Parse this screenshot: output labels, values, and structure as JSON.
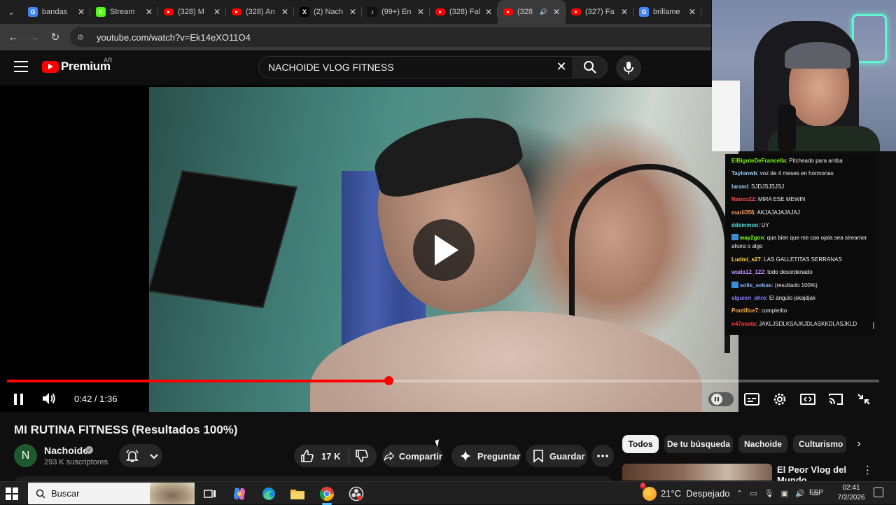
{
  "browser": {
    "tabs": [
      {
        "title": "bandas",
        "icon": "google-icon",
        "color": "#4285f4",
        "glyph": "G",
        "active": false
      },
      {
        "title": "Stream",
        "icon": "kick-icon",
        "color": "#53fc18",
        "glyph": "K",
        "active": false
      },
      {
        "title": "(328) M",
        "icon": "youtube-icon",
        "color": "#ff0000",
        "glyph": "",
        "active": false
      },
      {
        "title": "(328) An",
        "icon": "youtube-icon",
        "color": "#ff0000",
        "glyph": "",
        "active": false
      },
      {
        "title": "(2) Nach",
        "icon": "x-icon",
        "color": "#000000",
        "glyph": "X",
        "active": false
      },
      {
        "title": "(99+) En",
        "icon": "tiktok-icon",
        "color": "#111111",
        "glyph": "♪",
        "active": false
      },
      {
        "title": "(328) Fal",
        "icon": "youtube-icon",
        "color": "#ff0000",
        "glyph": "",
        "active": false
      },
      {
        "title": "(328",
        "icon": "youtube-icon",
        "color": "#ff0000",
        "glyph": "",
        "active": true
      },
      {
        "title": "(327) Fa",
        "icon": "youtube-icon",
        "color": "#ff0000",
        "glyph": "",
        "active": false
      },
      {
        "title": "brillame",
        "icon": "google-icon",
        "color": "#4285f4",
        "glyph": "G",
        "active": false
      }
    ],
    "url": "youtube.com/watch?v=Ek14eXO11O4"
  },
  "youtube": {
    "logo_text": "Premium",
    "country": "AR",
    "search_value": "NACHOIDE VLOG FITNESS"
  },
  "player": {
    "time": "0:42 / 1:36",
    "progress_fraction": 0.4375,
    "state": "paused-overlay"
  },
  "chat": [
    {
      "user": "ElBigoteDeFrancella",
      "text": "Pitcheado para arriba",
      "color": "#7cfc00",
      "badge": false
    },
    {
      "user": "Taylonwb",
      "text": "voz de 4 meses en hormonas",
      "color": "#9ad0ff",
      "badge": false
    },
    {
      "user": "larami",
      "text": "SJDJSJSJSJ",
      "color": "#9ad0ff",
      "badge": false
    },
    {
      "user": "Naoco22",
      "text": "MIRA ESE MEWIN",
      "color": "#ff4d4d",
      "badge": false
    },
    {
      "user": "marii356",
      "text": "AKJAJAJAJAJAJ",
      "color": "#ff9d5c",
      "badge": false
    },
    {
      "user": "ddemmoo",
      "text": "UY",
      "color": "#4cd9d9",
      "badge": false
    },
    {
      "user": "way2gon",
      "text": "que bien que me cae ojala sea streamer ahora o algo",
      "color": "#7cfc00",
      "badge": true
    },
    {
      "user": "Ludmi_s27",
      "text": "LAS GALLETITAS SERRANAS",
      "color": "#ffd84a",
      "badge": false
    },
    {
      "user": "wada12_122",
      "text": "todo desordenado",
      "color": "#c38cff",
      "badge": false
    },
    {
      "user": "solis_sebas",
      "text": "(resultado 100%)",
      "color": "#8ab4ff",
      "badge": true
    },
    {
      "user": "alguien_ahre",
      "text": "El ángulo jskajdjak",
      "color": "#8a7cff",
      "badge": false
    },
    {
      "user": "Pontifice7",
      "text": "completito",
      "color": "#ffb84a",
      "badge": false
    },
    {
      "user": "n47anata",
      "text": "JAKLJSDLKSAJKJDLASKKDLASJKLD",
      "color": "#ff3b3b",
      "badge": false
    }
  ],
  "video": {
    "title": "MI RUTINA FITNESS (Resultados 100%)",
    "channel": "Nachoide",
    "avatar_letter": "N",
    "subscribers": "293 K suscriptores",
    "likes": "17 K",
    "share_label": "Compartir",
    "ask_label": "Preguntar",
    "save_label": "Guardar"
  },
  "chips": [
    "Todos",
    "De tu búsqueda",
    "Nachoide",
    "Culturismo"
  ],
  "recommendation": {
    "title": "El Peor Vlog del Mundo"
  },
  "taskbar": {
    "search_placeholder": "Buscar",
    "weather": "21°C  Despejado",
    "weather_badge": "1",
    "lang": "ESP",
    "time": "02:41",
    "date": "7/2/2026"
  }
}
